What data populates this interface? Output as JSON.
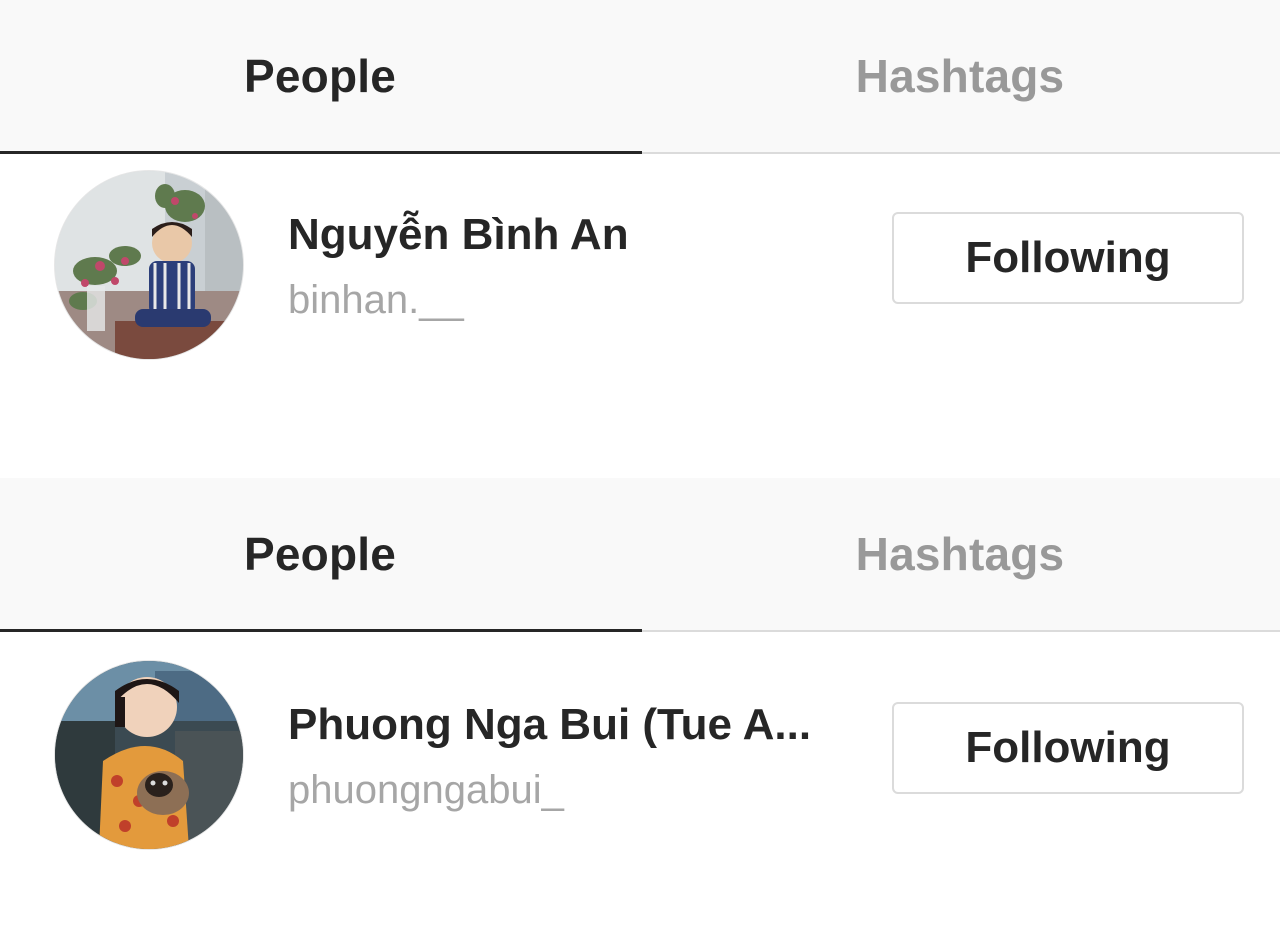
{
  "panels": [
    {
      "tabs": {
        "people": "People",
        "hashtags": "Hashtags",
        "active": "people"
      },
      "result": {
        "display_name": "Nguyễn Bình An",
        "username": "binhan.__",
        "follow_label": "Following"
      }
    },
    {
      "tabs": {
        "people": "People",
        "hashtags": "Hashtags",
        "active": "people"
      },
      "result": {
        "display_name": "Phuong Nga Bui (Tue A...",
        "username": "phuongngabui_",
        "follow_label": "Following"
      }
    }
  ],
  "colors": {
    "primary_text": "#262626",
    "secondary_text": "#999999",
    "tab_bar_bg": "#f9f9f9",
    "border": "#dbdbdb"
  }
}
